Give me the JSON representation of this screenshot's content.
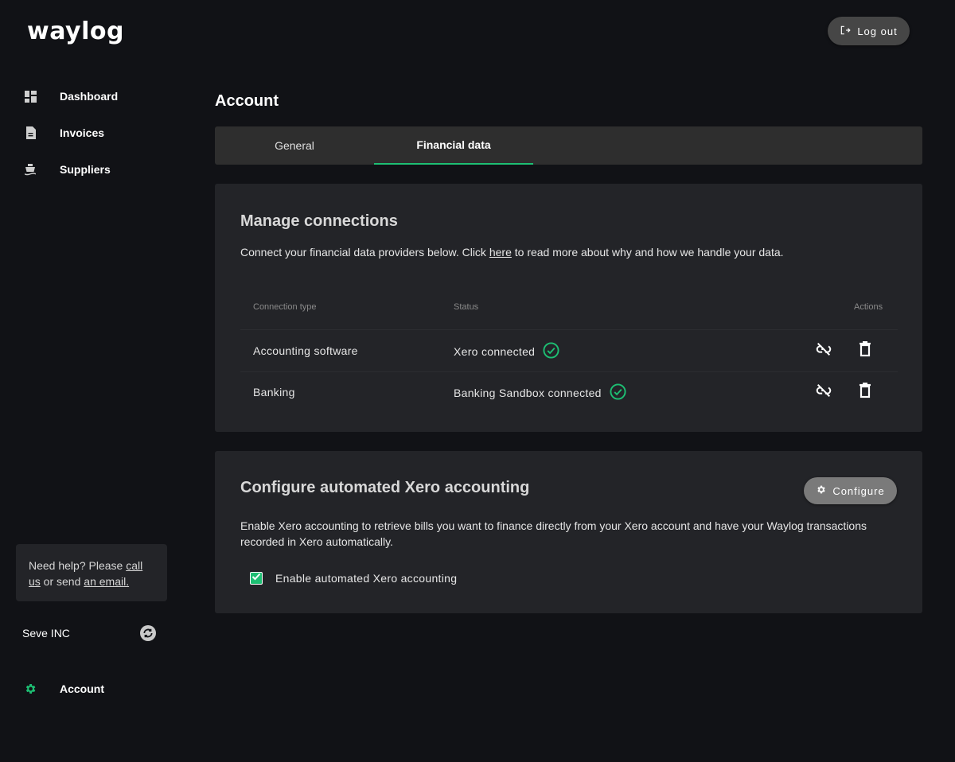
{
  "brand": {
    "logo": "waylog"
  },
  "header": {
    "logout_label": "Log out"
  },
  "sidebar": {
    "items": [
      {
        "label": "Dashboard",
        "icon": "dashboard-icon"
      },
      {
        "label": "Invoices",
        "icon": "document-icon"
      },
      {
        "label": "Suppliers",
        "icon": "ship-icon"
      }
    ],
    "help": {
      "prefix": "Need help? Please ",
      "call_link": "call us",
      "middle": " or send ",
      "email_link": "an email."
    },
    "company": {
      "name": "Seve INC",
      "switch_icon": "sync-icon"
    },
    "account": {
      "label": "Account",
      "icon": "gear-icon"
    }
  },
  "main": {
    "title": "Account",
    "tabs": [
      {
        "label": "General",
        "active": false
      },
      {
        "label": "Financial data",
        "active": true
      }
    ],
    "connections": {
      "title": "Manage connections",
      "desc_prefix": "Connect your financial data providers below. Click ",
      "desc_link": "here",
      "desc_suffix": " to read more about why and how we handle your data.",
      "columns": [
        "Connection type",
        "Status",
        "Actions"
      ],
      "rows": [
        {
          "type": "Accounting software",
          "status": "Xero connected",
          "status_icon": "check-circle-icon"
        },
        {
          "type": "Banking",
          "status": "Banking Sandbox connected",
          "status_icon": "check-circle-icon"
        }
      ]
    },
    "xero": {
      "title": "Configure automated Xero accounting",
      "configure_label": "Configure",
      "description": "Enable Xero accounting to retrieve bills you want to finance directly from your Xero account and have your Waylog transactions recorded in Xero automatically.",
      "checkbox_label": "Enable automated Xero accounting",
      "checkbox_checked": true
    }
  },
  "colors": {
    "accent": "#1dbf73",
    "background": "#111216",
    "card": "#232428"
  }
}
